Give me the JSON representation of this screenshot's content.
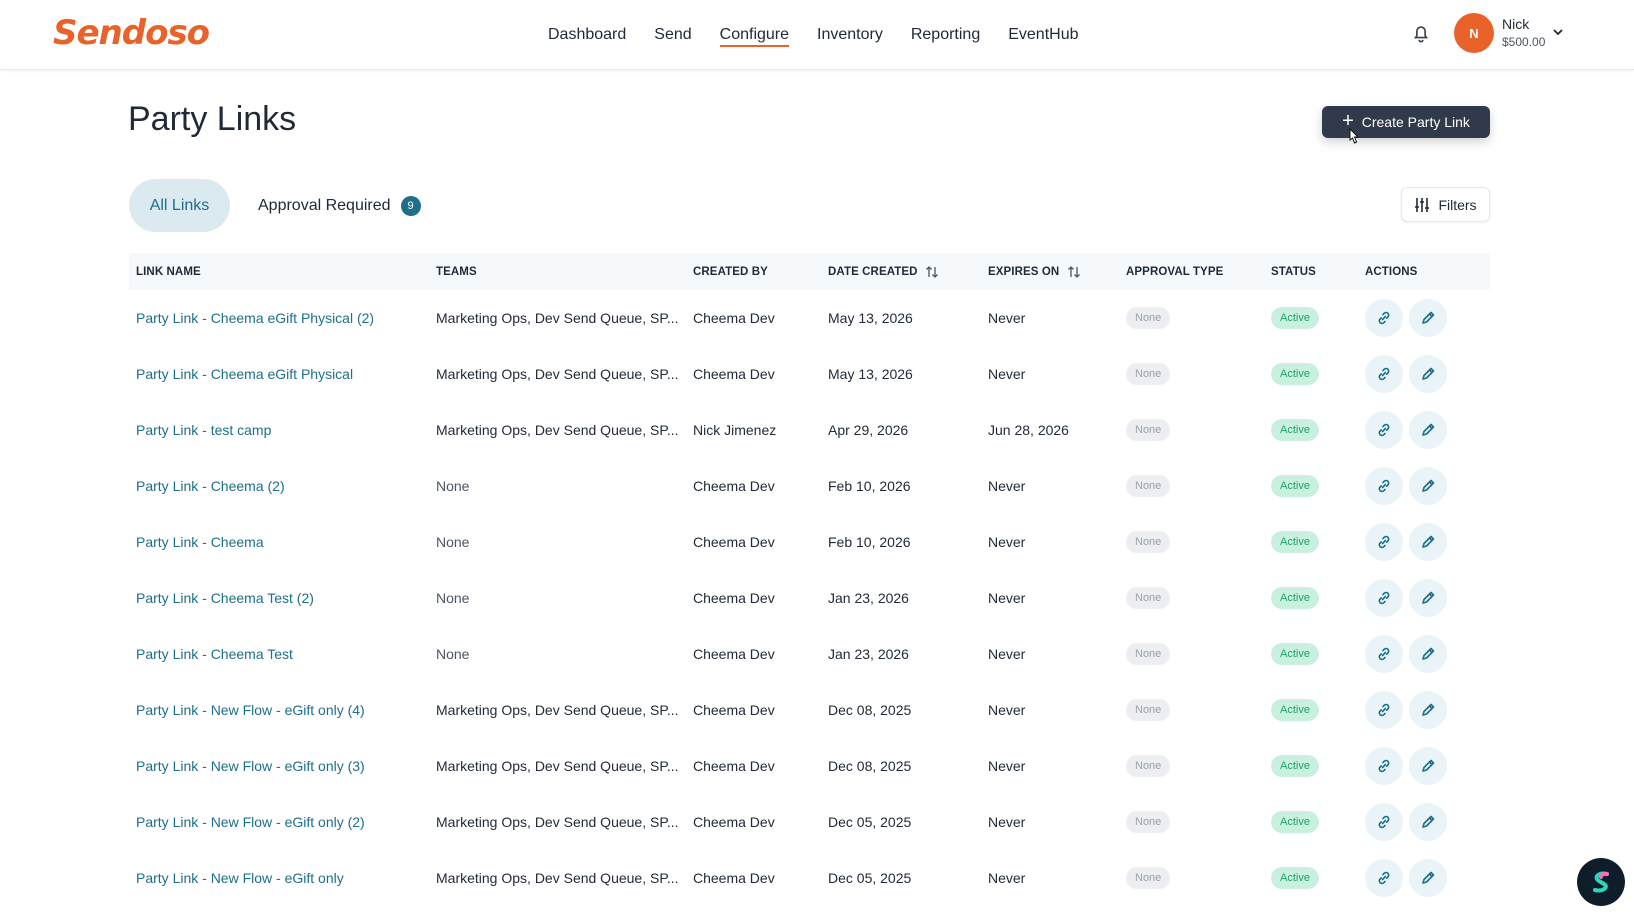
{
  "brand": {
    "logo_text": "Sendoso",
    "accent": "#e8622a",
    "teal": "#1d6f8a"
  },
  "nav": {
    "items": [
      {
        "label": "Dashboard",
        "active": false
      },
      {
        "label": "Send",
        "active": false
      },
      {
        "label": "Configure",
        "active": true
      },
      {
        "label": "Inventory",
        "active": false
      },
      {
        "label": "Reporting",
        "active": false
      },
      {
        "label": "EventHub",
        "active": false
      }
    ]
  },
  "user": {
    "initial": "N",
    "name": "Nick",
    "balance": "$500.00"
  },
  "page": {
    "title": "Party Links",
    "create_button": "Create Party Link",
    "filters_button": "Filters"
  },
  "tabs": {
    "all_links": "All Links",
    "approval_required": "Approval Required",
    "approval_count": "9"
  },
  "table": {
    "columns": [
      "Link Name",
      "Teams",
      "Created By",
      "Date Created",
      "Expires On",
      "Approval Type",
      "Status",
      "Actions"
    ],
    "rows": [
      {
        "name": "Party Link - Cheema eGift Physical (2)",
        "teams": "Marketing Ops, Dev Send Queue, SP...",
        "created_by": "Cheema Dev",
        "date_created": "May 13, 2026",
        "expires_on": "Never",
        "approval": "None",
        "status": "Active"
      },
      {
        "name": "Party Link - Cheema eGift Physical",
        "teams": "Marketing Ops, Dev Send Queue, SP...",
        "created_by": "Cheema Dev",
        "date_created": "May 13, 2026",
        "expires_on": "Never",
        "approval": "None",
        "status": "Active"
      },
      {
        "name": "Party Link - test camp",
        "teams": "Marketing Ops, Dev Send Queue, SP...",
        "created_by": "Nick Jimenez",
        "date_created": "Apr 29, 2026",
        "expires_on": "Jun 28, 2026",
        "approval": "None",
        "status": "Active"
      },
      {
        "name": "Party Link - Cheema (2)",
        "teams": "None",
        "created_by": "Cheema Dev",
        "date_created": "Feb 10, 2026",
        "expires_on": "Never",
        "approval": "None",
        "status": "Active"
      },
      {
        "name": "Party Link - Cheema",
        "teams": "None",
        "created_by": "Cheema Dev",
        "date_created": "Feb 10, 2026",
        "expires_on": "Never",
        "approval": "None",
        "status": "Active"
      },
      {
        "name": "Party Link - Cheema Test (2)",
        "teams": "None",
        "created_by": "Cheema Dev",
        "date_created": "Jan 23, 2026",
        "expires_on": "Never",
        "approval": "None",
        "status": "Active"
      },
      {
        "name": "Party Link - Cheema Test",
        "teams": "None",
        "created_by": "Cheema Dev",
        "date_created": "Jan 23, 2026",
        "expires_on": "Never",
        "approval": "None",
        "status": "Active"
      },
      {
        "name": "Party Link - New Flow - eGift only (4)",
        "teams": "Marketing Ops, Dev Send Queue, SP...",
        "created_by": "Cheema Dev",
        "date_created": "Dec 08, 2025",
        "expires_on": "Never",
        "approval": "None",
        "status": "Active"
      },
      {
        "name": "Party Link - New Flow - eGift only (3)",
        "teams": "Marketing Ops, Dev Send Queue, SP...",
        "created_by": "Cheema Dev",
        "date_created": "Dec 08, 2025",
        "expires_on": "Never",
        "approval": "None",
        "status": "Active"
      },
      {
        "name": "Party Link - New Flow - eGift only (2)",
        "teams": "Marketing Ops, Dev Send Queue, SP...",
        "created_by": "Cheema Dev",
        "date_created": "Dec 05, 2025",
        "expires_on": "Never",
        "approval": "None",
        "status": "Active"
      },
      {
        "name": "Party Link - New Flow - eGift only",
        "teams": "Marketing Ops, Dev Send Queue, SP...",
        "created_by": "Cheema Dev",
        "date_created": "Dec 05, 2025",
        "expires_on": "Never",
        "approval": "None",
        "status": "Active"
      }
    ]
  },
  "icons": {
    "bell": "bell-icon",
    "chevron": "chevron-down-icon",
    "plus": "plus-icon",
    "filters": "sliders-icon",
    "sort": "sort-icon",
    "copy_link": "link-icon",
    "edit": "pencil-icon",
    "widget": "sendoso-logo-icon"
  }
}
